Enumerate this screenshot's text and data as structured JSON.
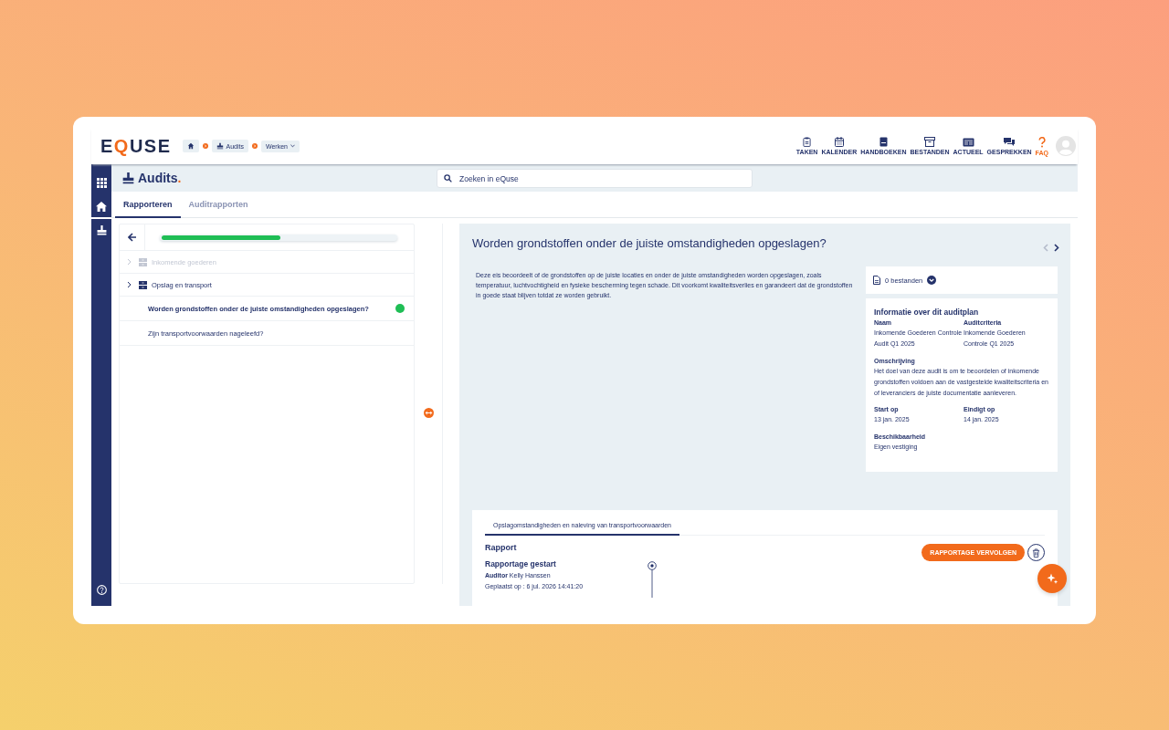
{
  "logo": "EQUSE",
  "breadcrumbs": [
    {
      "kind": "home"
    },
    {
      "kind": "link",
      "label": "Audits"
    },
    {
      "kind": "dropdown",
      "label": "Werken"
    }
  ],
  "nav": [
    {
      "label": "TAKEN",
      "highlighted": false
    },
    {
      "label": "KALENDER",
      "highlighted": false
    },
    {
      "label": "HANDBOEKEN",
      "highlighted": false
    },
    {
      "label": "BESTANDEN",
      "highlighted": false
    },
    {
      "label": "ACTUEEL",
      "highlighted": false
    },
    {
      "label": "GESPREKKEN",
      "highlighted": false
    },
    {
      "label": "FAQ",
      "highlighted": true
    }
  ],
  "sidebar": {
    "items": [
      {
        "selected": false
      },
      {
        "selected": true
      },
      {
        "selected": false
      }
    ]
  },
  "page_title": "Audits.",
  "search": {
    "placeholder": "Zoeken in eQuse"
  },
  "tabs": [
    {
      "label": "Rapporteren",
      "selected": true
    },
    {
      "label": "Auditrapporten",
      "selected": false
    }
  ],
  "progress": {
    "level": 0.5
  },
  "tree": [
    {
      "label": "Inkomende goederen",
      "disabled": true
    },
    {
      "label": "Opslag en transport",
      "disabled": false,
      "children": [
        {
          "label": "Worden grondstoffen onder de juiste omstandigheden opgeslagen?",
          "selected": true,
          "answered": true
        },
        {
          "label": "Zijn transportvoorwaarden nageleefd?",
          "selected": false,
          "answered": false
        }
      ]
    }
  ],
  "question": {
    "title": "Worden grondstoffen onder de juiste omstandigheden opgeslagen?",
    "prev_disabled": true,
    "next_disabled": false,
    "description": "Deze eis beoordeelt of de grondstoffen op de juiste locaties en onder de juiste omstandigheden worden opgeslagen, zoals temperatuur, luchtvochtigheid en fysieke bescherming tegen schade. Dit voorkomt kwaliteitsverlies en garandeert dat de grondstoffen in goede staat blijven totdat ze worden gebruikt."
  },
  "files": {
    "label": "0 bestanden"
  },
  "info": {
    "title": "Informatie over dit auditplan",
    "fields": [
      {
        "label": "Naam",
        "value": "Inkomende Goederen Controle Audit Q1 2025",
        "wide": false
      },
      {
        "label": "Auditcriteria",
        "value": "Inkomende Goederen Controle Q1 2025",
        "wide": false
      },
      {
        "label": "Omschrijving",
        "value": "Het doel van deze audit is om te beoordelen of inkomende grondstoffen voldoen aan de vastgestelde kwaliteitscriteria en of leveranciers de juiste documentatie aanleveren.",
        "wide": true
      },
      {
        "label": "Start op",
        "value": "13 jan. 2025",
        "wide": false
      },
      {
        "label": "Eindigt op",
        "value": "14 jan. 2025",
        "wide": false
      },
      {
        "label": "Beschikbaarheid",
        "value": "Eigen vestiging",
        "wide": false
      }
    ]
  },
  "report": {
    "tabs": [
      {
        "label": "Opslagomstandigheden en naleving van transportvoorwaarden",
        "selected": true
      }
    ],
    "title": "Rapport",
    "button": "RAPPORTAGE VERVOLGEN",
    "entries": [
      {
        "title": "Rapportage gestart",
        "auditor": "**Auditor** Kelly Hanssen",
        "posted": "Geplaatst op : 6 jul. 2026 14:41:20"
      }
    ]
  }
}
